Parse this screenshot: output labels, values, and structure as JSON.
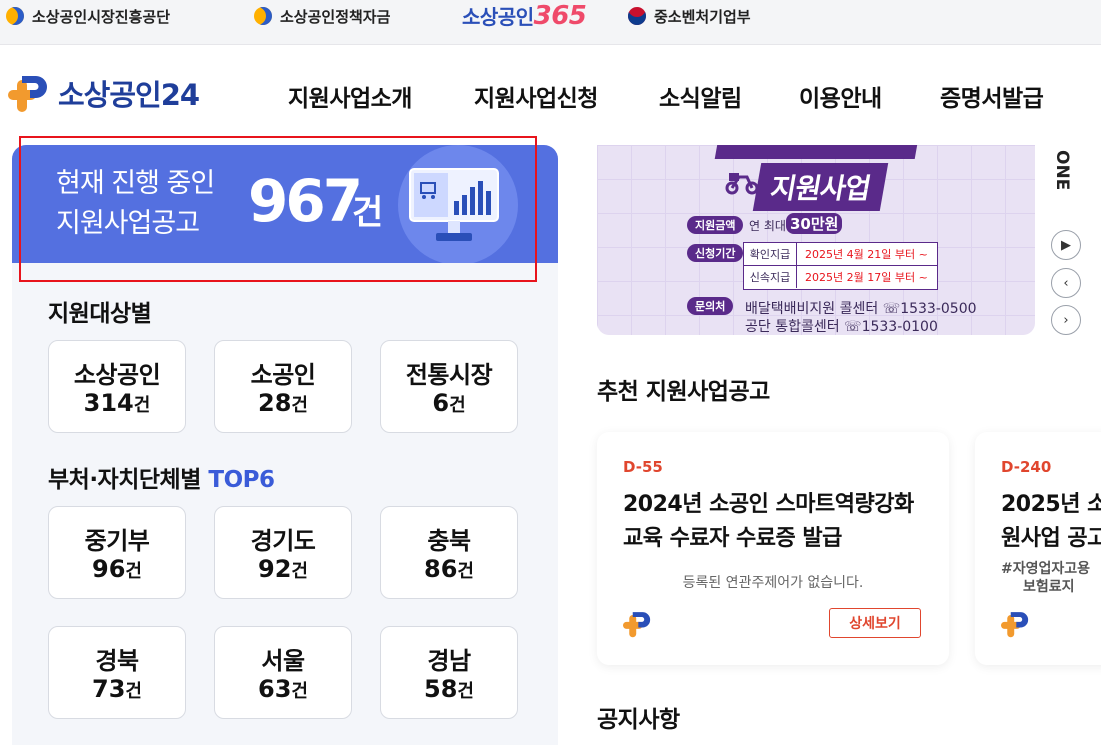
{
  "topbar": {
    "links": [
      "소상공인시장진흥공단",
      "소상공인정책자금",
      "중소벤처기업부"
    ],
    "brand365_text": "소상공인",
    "brand365_num": "365"
  },
  "header": {
    "logo_text": "소상공인24",
    "nav": [
      "지원사업소개",
      "지원사업신청",
      "소식알림",
      "이용안내",
      "증명서발급"
    ]
  },
  "banner": {
    "line1": "현재 진행 중인",
    "line2": "지원사업공고",
    "count": "967",
    "unit": "건"
  },
  "by_target": {
    "title": "지원대상별",
    "cards": [
      {
        "name": "소상공인",
        "count": "314",
        "unit": "건"
      },
      {
        "name": "소공인",
        "count": "28",
        "unit": "건"
      },
      {
        "name": "전통시장",
        "count": "6",
        "unit": "건"
      }
    ]
  },
  "by_region": {
    "title": "부처·자치단체별",
    "highlight": "TOP6",
    "cards": [
      {
        "name": "중기부",
        "count": "96",
        "unit": "건"
      },
      {
        "name": "경기도",
        "count": "92",
        "unit": "건"
      },
      {
        "name": "충북",
        "count": "86",
        "unit": "건"
      },
      {
        "name": "경북",
        "count": "73",
        "unit": "건"
      },
      {
        "name": "서울",
        "count": "63",
        "unit": "건"
      },
      {
        "name": "경남",
        "count": "58",
        "unit": "건"
      }
    ]
  },
  "promo": {
    "title": "지원사업",
    "label_amount": "지원금액",
    "amount_prefix": "연 최대",
    "amount": "30만원",
    "label_period": "신청기간",
    "rows": [
      {
        "k": "확인지급",
        "v": "2025년 4월 21일 부터 ~"
      },
      {
        "k": "신속지급",
        "v": "2025년 2월 17일 부터 ~"
      }
    ],
    "label_contact": "문의처",
    "contact1": "배달택배비지원 콜센터 ☏1533-0500",
    "contact2": "공단 통합콜센터 ☏1533-0100",
    "side_text": "ONE"
  },
  "recommend": {
    "title": "추천 지원사업공고",
    "cards": [
      {
        "dday": "D-55",
        "title1": "2024년 소공인 스마트역량강화",
        "title2": "교육 수료자 수료증 발급",
        "sub": "등록된 연관주제어가 없습니다.",
        "button": "상세보기"
      },
      {
        "dday": "D-240",
        "title1": "2025년 소",
        "title2": "원사업 공고",
        "sub1": "#자영업자고용",
        "sub2": "보험료지"
      }
    ]
  },
  "notice": {
    "title": "공지사항"
  },
  "colors": {
    "brand_blue": "#1f3e9a",
    "banner_blue": "#5470e0",
    "accent_orange": "#e0462e",
    "highlight_red": "#e8141c"
  }
}
